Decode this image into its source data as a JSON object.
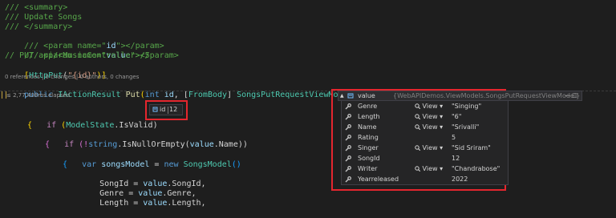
{
  "code": {
    "line1": "/// <summary>",
    "line2": "/// Update Songs",
    "line3": "/// </summary>",
    "line4_a": "/// <param name=\"",
    "line4_b": "id",
    "line4_c": "\"></param>",
    "line5_a": "/// <param name=\"",
    "line5_b": "value",
    "line5_c": "\"></param>",
    "line6": "// PUT api/<MusicController>/5",
    "line7_a": "[",
    "line7_b": "HttpPut",
    "line7_c": "(",
    "line7_d": "\"{id}\"",
    "line7_e": ")]",
    "line8_public": "public",
    "line8_type": "IActionResult",
    "line8_method": "Put",
    "line8_open": "(",
    "line8_int": "int",
    "line8_id": "id",
    "line8_comma": ", [",
    "line8_frombody": "FromBody",
    "line8_close": "] ",
    "line8_vmtype": "SongsPutRequestViewModel",
    "line8_value": "value",
    "line8_end": ")",
    "line9_if": "if",
    "line9_rest_a": " (",
    "line9_model": "ModelState",
    "line9_rest_b": ".IsValid)",
    "line10": "{",
    "line11_if": "if",
    "line11_a": " (!",
    "line11_string": "string",
    "line11_b": ".IsNullOrEmpty(",
    "line11_value": "value",
    "line11_c": ".Name))",
    "line12": "{",
    "line13_var": "var",
    "line13_name": "songsModel",
    "line13_eq": " = ",
    "line13_new": "new",
    "line13_type": "SongsModel",
    "line13_end": "()",
    "line14": "{",
    "line15_a": "SongId = ",
    "line15_value": "value",
    "line15_b": ".SongId,",
    "line16_a": "Genre = ",
    "line16_value": "value",
    "line16_b": ".Genre,",
    "line17_a": "Length = ",
    "line17_value": "value",
    "line17_b": ".Length,"
  },
  "codelens": "0 references | 0 changes | 0 authors, 0 changes",
  "elapsed": "≤ 2,77,408ms elapsed",
  "small_tip": {
    "name": "id",
    "value": "12"
  },
  "datatip": {
    "name": "value",
    "type": "{WebAPIDemos.ViewModels.SongsPutRequestViewModel}",
    "controls": "— □",
    "view_label": "View",
    "properties": [
      {
        "name": "Genre",
        "viewer": true,
        "value": "\"Singing\""
      },
      {
        "name": "Length",
        "viewer": true,
        "value": "\"6\""
      },
      {
        "name": "Name",
        "viewer": true,
        "value": "\"Srivalli\""
      },
      {
        "name": "Rating",
        "viewer": false,
        "value": "5"
      },
      {
        "name": "Singer",
        "viewer": true,
        "value": "\"Sid Sriram\""
      },
      {
        "name": "SongId",
        "viewer": false,
        "value": "12"
      },
      {
        "name": "Writer",
        "viewer": true,
        "value": "\"Chandrabose\""
      },
      {
        "name": "Yearreleased",
        "viewer": false,
        "value": "2022"
      }
    ]
  },
  "colors": {
    "background": "#1e1e1e",
    "highlight_box": "#e4262e",
    "comment": "#57a64a",
    "keyword": "#569cd6",
    "type": "#4ec9b0"
  },
  "icons": {
    "datatip_pin": "pin-icon",
    "object": "object-icon",
    "property": "wrench-icon",
    "viewer": "magnifier-icon"
  }
}
